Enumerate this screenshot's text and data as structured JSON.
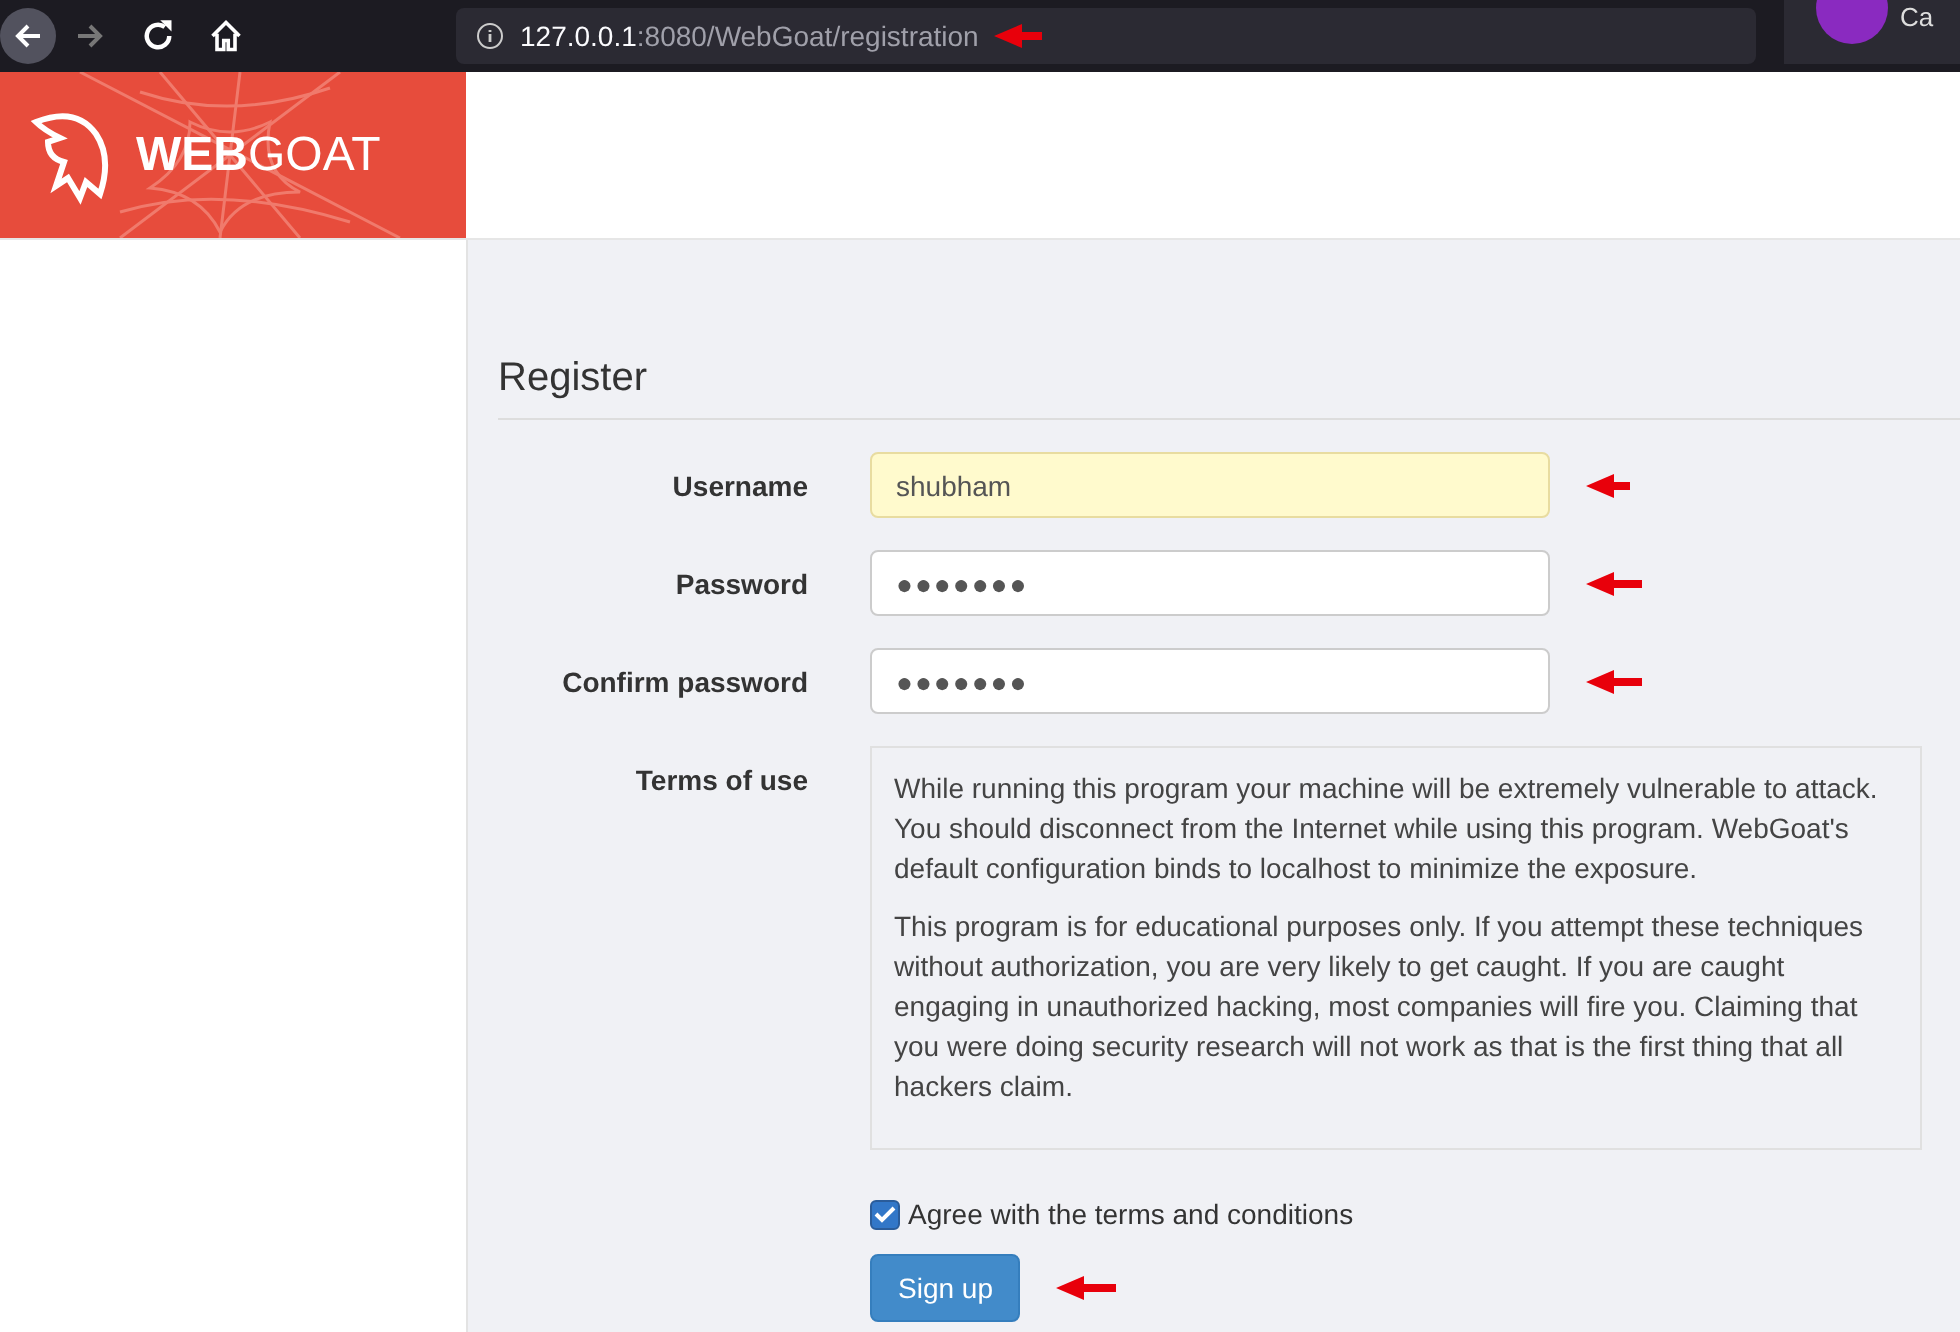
{
  "browser": {
    "url_host": "127.0.0.1",
    "url_rest": ":8080/WebGoat/registration",
    "profile_text": "Ca"
  },
  "logo": {
    "bold": "WEB",
    "light": "GOAT"
  },
  "form": {
    "title": "Register",
    "fields": [
      {
        "label": "Username",
        "value": "shubham",
        "kind": "text",
        "autofilled": true
      },
      {
        "label": "Password",
        "value": "●●●●●●●",
        "kind": "password",
        "autofilled": false
      },
      {
        "label": "Confirm password",
        "value": "●●●●●●●",
        "kind": "password",
        "autofilled": false
      }
    ],
    "terms_label": "Terms of use",
    "terms": [
      "While running this program your machine will be extremely vulnerable to attack. You should disconnect from the Internet while using this program. WebGoat's default configuration binds to localhost to minimize the exposure.",
      "This program is for educational purposes only. If you attempt these techniques without authorization, you are very likely to get caught. If you are caught engaging in unauthorized hacking, most companies will fire you. Claiming that you were doing security research will not work as that is the first thing that all hackers claim."
    ],
    "agree": {
      "label": "Agree with the terms and conditions",
      "checked": true
    },
    "submit": "Sign up"
  }
}
